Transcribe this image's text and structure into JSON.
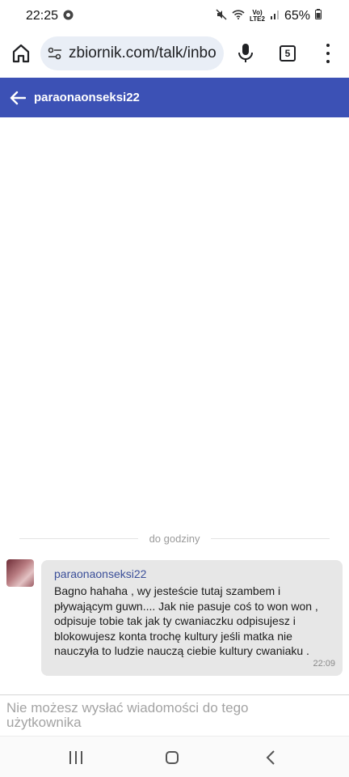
{
  "status_bar": {
    "time": "22:25",
    "network_label": "Vo)\nLTE2",
    "battery": "65%"
  },
  "browser": {
    "url": "zbiornik.com/talk/inbo",
    "tab_count": "5"
  },
  "chat": {
    "title": "paraonaonseksi22",
    "divider": "do godziny",
    "message": {
      "author": "paraonaonseksi22",
      "text": "Bagno hahaha , wy jesteście tutaj szambem i pływającym guwn.... Jak nie pasuje coś to won won , odpisuje tobie tak jak ty cwaniaczku odpisujesz i blokowujesz konta trochę kultury jeśli matka nie nauczyła to ludzie nauczą ciebie kultury cwaniaku .",
      "time": "22:09"
    },
    "input_notice": "Nie możesz wysłać wiadomości do tego użytkownika"
  },
  "colors": {
    "header": "#3c51b5",
    "bubble": "#e7e7e7",
    "author": "#3b4f99"
  }
}
